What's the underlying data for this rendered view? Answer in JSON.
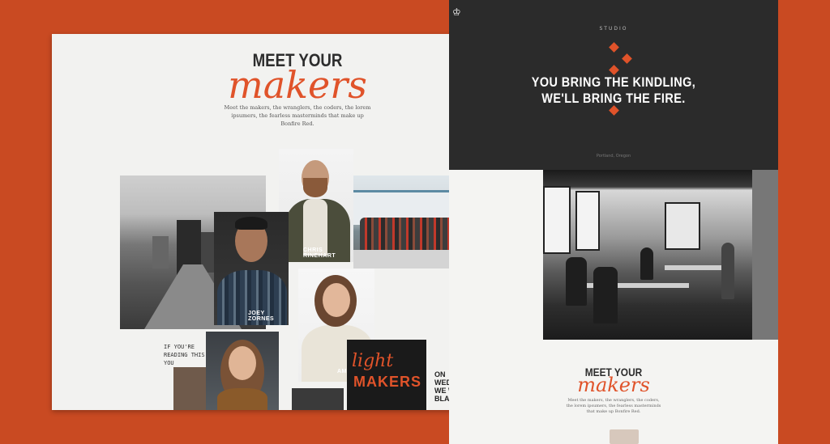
{
  "colors": {
    "accent": "#e0532a",
    "background": "#c94a22",
    "dark": "#2b2b2b"
  },
  "left_page": {
    "title": "MEET YOUR",
    "script": "makers",
    "intro": "Meet the makers, the wranglers, the coders, the lorem ipsumers, the fearless masterminds that make up Bonfire Red.",
    "people": {
      "chris": "CHRIS RINEHART",
      "joey": "JOEY ZORNES",
      "amy": "AMY HAMM"
    },
    "handnote": "IF YOU'RE READING THIS YOU",
    "neon_line1": "light",
    "neon_line2": "MAKERS",
    "wednesday": [
      "ON",
      "WEDNESDAY",
      "WE WEAR",
      "BLACK"
    ]
  },
  "right_page": {
    "studio_label": "STUDIO",
    "tagline_line1": "YOU BRING THE KINDLING,",
    "tagline_line2": "WE'LL BRING THE FIRE.",
    "hero_small": "Portland, Oregon",
    "meet_title": "MEET YOUR",
    "meet_script": "makers",
    "meet_intro": "Meet the makers, the wranglers, the coders, the lorem ipsumers, the fearless masterminds that make up Bonfire Red."
  },
  "icons": {
    "logo": "crown-logo-icon"
  }
}
